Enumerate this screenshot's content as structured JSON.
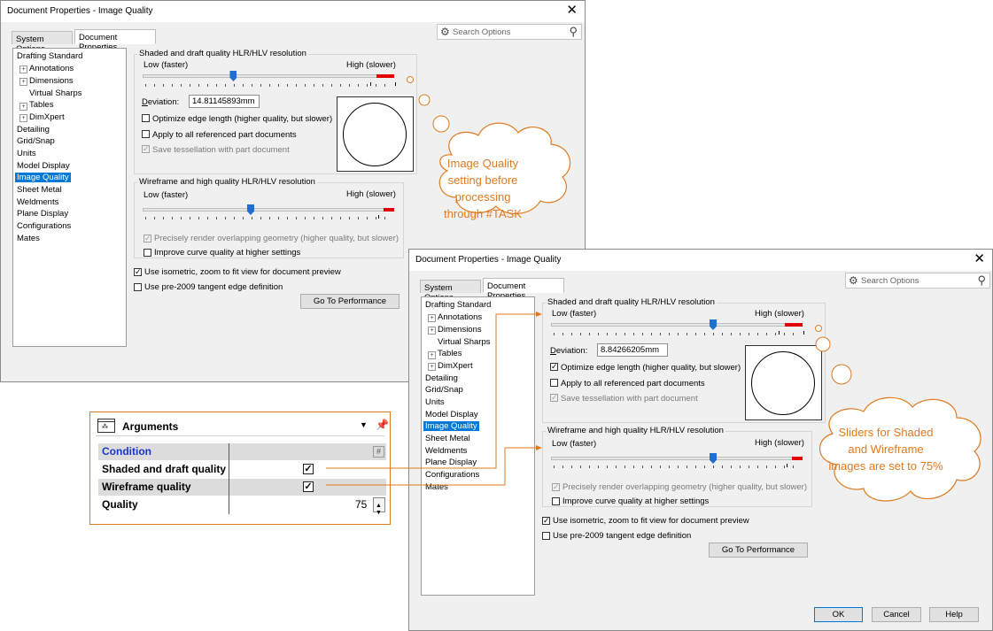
{
  "back_dialog": {
    "title": "Document Properties - Image Quality",
    "close_glyph": "✕",
    "tabs": [
      "System Options",
      "Document Properties"
    ],
    "search_placeholder": "Search Options",
    "tree": {
      "items": [
        "Drafting Standard",
        "Annotations",
        "Dimensions",
        "Virtual Sharps",
        "Tables",
        "DimXpert",
        "Detailing",
        "Grid/Snap",
        "Units",
        "Model Display",
        "Image Quality",
        "Sheet Metal",
        "Weldments",
        "Plane Display",
        "Configurations",
        "Mates"
      ]
    },
    "shaded": {
      "group_title": "Shaded and draft quality HLR/HLV resolution",
      "low_label": "Low (faster)",
      "high_label": "High (slower)",
      "slider_value": 0.42,
      "deviation_label": "Deviation:",
      "deviation_value": "14.81145893mm",
      "optimize_label": "Optimize edge length (higher quality, but slower)",
      "optimize_checked": false,
      "apply_label": "Apply to all referenced part documents",
      "apply_checked": false,
      "save_label": "Save tessellation with part document",
      "save_checked": true
    },
    "wireframe": {
      "group_title": "Wireframe and high quality HLR/HLV resolution",
      "low_label": "Low (faster)",
      "high_label": "High (slower)",
      "slider_value": 0.5,
      "precise_label": "Precisely render overlapping geometry (higher quality, but slower)",
      "precise_checked": true,
      "curve_label": "Improve curve quality at higher settings",
      "curve_checked": false
    },
    "isometric_label": "Use isometric, zoom to fit view for document preview",
    "isometric_checked": true,
    "pre2009_label": "Use pre-2009 tangent edge definition",
    "pre2009_checked": false,
    "perf_button": "Go To Performance"
  },
  "front_dialog": {
    "title": "Document Properties - Image Quality",
    "close_glyph": "✕",
    "tabs": [
      "System Options",
      "Document Properties"
    ],
    "search_placeholder": "Search Options",
    "tree": {
      "items": [
        "Drafting Standard",
        "Annotations",
        "Dimensions",
        "Virtual Sharps",
        "Tables",
        "DimXpert",
        "Detailing",
        "Grid/Snap",
        "Units",
        "Model Display",
        "Image Quality",
        "Sheet Metal",
        "Weldments",
        "Plane Display",
        "Configurations",
        "Mates"
      ]
    },
    "shaded": {
      "group_title": "Shaded and draft quality HLR/HLV resolution",
      "low_label": "Low (faster)",
      "high_label": "High (slower)",
      "slider_value": 0.75,
      "deviation_label": "Deviation:",
      "deviation_value": "8.84266205mm",
      "optimize_label": "Optimize edge length (higher quality, but slower)",
      "optimize_checked": true,
      "apply_label": "Apply to all referenced part documents",
      "apply_checked": false,
      "save_label": "Save tessellation with part document",
      "save_checked": true
    },
    "wireframe": {
      "group_title": "Wireframe and high quality HLR/HLV resolution",
      "low_label": "Low (faster)",
      "high_label": "High (slower)",
      "slider_value": 0.75,
      "precise_label": "Precisely render overlapping geometry (higher quality, but slower)",
      "precise_checked": true,
      "curve_label": "Improve curve quality at higher settings",
      "curve_checked": false
    },
    "isometric_label": "Use isometric, zoom to fit view for document preview",
    "isometric_checked": true,
    "pre2009_label": "Use pre-2009 tangent edge definition",
    "pre2009_checked": false,
    "perf_button": "Go To Performance",
    "ok_button": "OK",
    "cancel_button": "Cancel",
    "help_button": "Help"
  },
  "callout_before": "Image Quality setting before processing through #TASK",
  "callout_after": "Sliders for Shaded and Wireframe images are set to 75%",
  "arguments_panel": {
    "title": "Arguments",
    "hash_glyph": "#",
    "condition_label": "Condition",
    "shaded_label": "Shaded and draft quality",
    "shaded_checked": true,
    "wireframe_label": "Wireframe quality",
    "wireframe_checked": true,
    "quality_label": "Quality",
    "quality_value": "75"
  },
  "colors": {
    "accent_orange": "#e07a1f",
    "selection_blue": "#0078d7",
    "slider_thumb": "#1e6fd0",
    "slider_red": "#e00000"
  }
}
